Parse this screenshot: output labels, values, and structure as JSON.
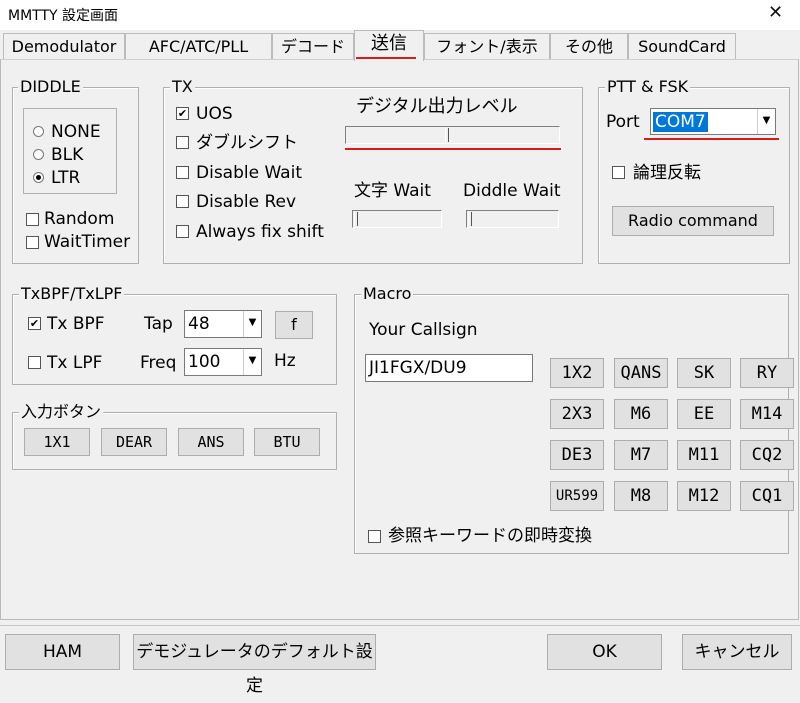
{
  "window": {
    "title": "MMTTY 設定画面",
    "close": "✕"
  },
  "tabs": [
    "Demodulator",
    "AFC/ATC/PLL",
    "デコード",
    "送信",
    "フォント/表示",
    "その他",
    "SoundCard"
  ],
  "diddle": {
    "label": "DIDDLE",
    "options": [
      "NONE",
      "BLK",
      "LTR"
    ],
    "selected": "LTR",
    "checks": [
      "Random",
      "WaitTimer"
    ]
  },
  "tx": {
    "label": "TX",
    "checks": [
      "UOS",
      "ダブルシフト",
      "Disable Wait",
      "Disable Rev",
      "Always fix shift"
    ],
    "checked": [
      "UOS"
    ],
    "digital_level": "デジタル出力レベル",
    "char_wait": "文字 Wait",
    "diddle_wait": "Diddle Wait",
    "digital_level_value": 0.47,
    "char_wait_value": 0.0,
    "diddle_wait_value": 0.0
  },
  "ptt": {
    "label": "PTT & FSK",
    "port_label": "Port",
    "port_value": "COM7",
    "invert": "論理反転",
    "radio_command": "Radio command"
  },
  "txbpf": {
    "label": "TxBPF/TxLPF",
    "bpf": "Tx BPF",
    "lpf": "Tx LPF",
    "tap_label": "Tap",
    "tap_value": "48",
    "f_button": "f",
    "freq_label": "Freq",
    "freq_value": "100",
    "hz": "Hz"
  },
  "input_buttons": {
    "label": "入力ボタン",
    "buttons": [
      "1X1",
      "DEAR",
      "ANS",
      "BTU"
    ]
  },
  "macro": {
    "label": "Macro",
    "callsign_label": "Your Callsign",
    "callsign_value": "JI1FGX/DU9",
    "buttons": [
      "1X2",
      "QANS",
      "SK",
      "RY",
      "2X3",
      "M6",
      "EE",
      "M14",
      "DE3",
      "M7",
      "M11",
      "CQ2",
      "UR599",
      "M8",
      "M12",
      "CQ1"
    ],
    "immediate": "参照キーワードの即時変換"
  },
  "footer": {
    "ham": "HAM",
    "default": "デモジュレータのデフォルト設定",
    "ok": "OK",
    "cancel": "キャンセル"
  },
  "colors": {
    "annotation": "#d81b1b",
    "selection": "#0078d7"
  }
}
